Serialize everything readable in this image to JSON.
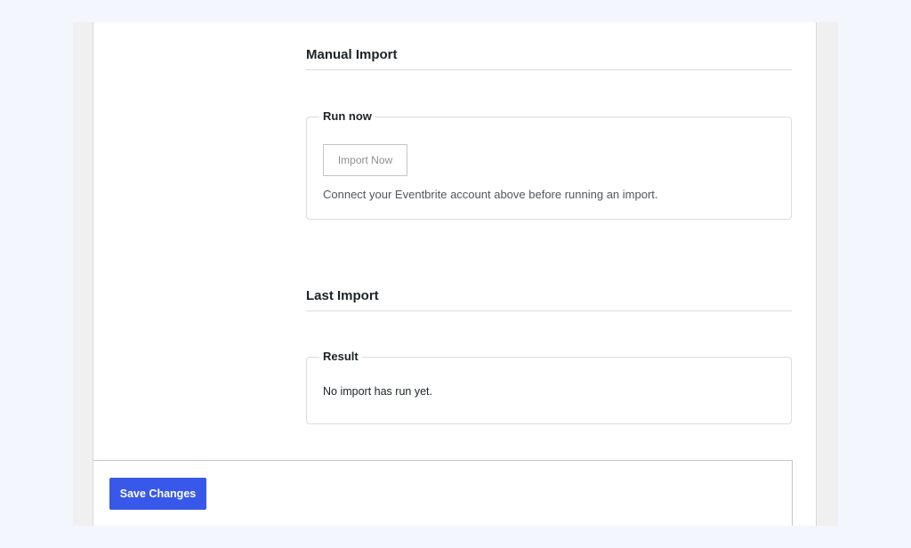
{
  "manual_import": {
    "title": "Manual Import",
    "run_now": {
      "legend": "Run now",
      "button_label": "Import Now",
      "help_text": "Connect your Eventbrite account above before running an import."
    }
  },
  "last_import": {
    "title": "Last Import",
    "result": {
      "legend": "Result",
      "text": "No import has run yet."
    }
  },
  "footer": {
    "save_label": "Save Changes"
  },
  "colors": {
    "accent": "#3858e9",
    "background": "#f3f6fd"
  }
}
